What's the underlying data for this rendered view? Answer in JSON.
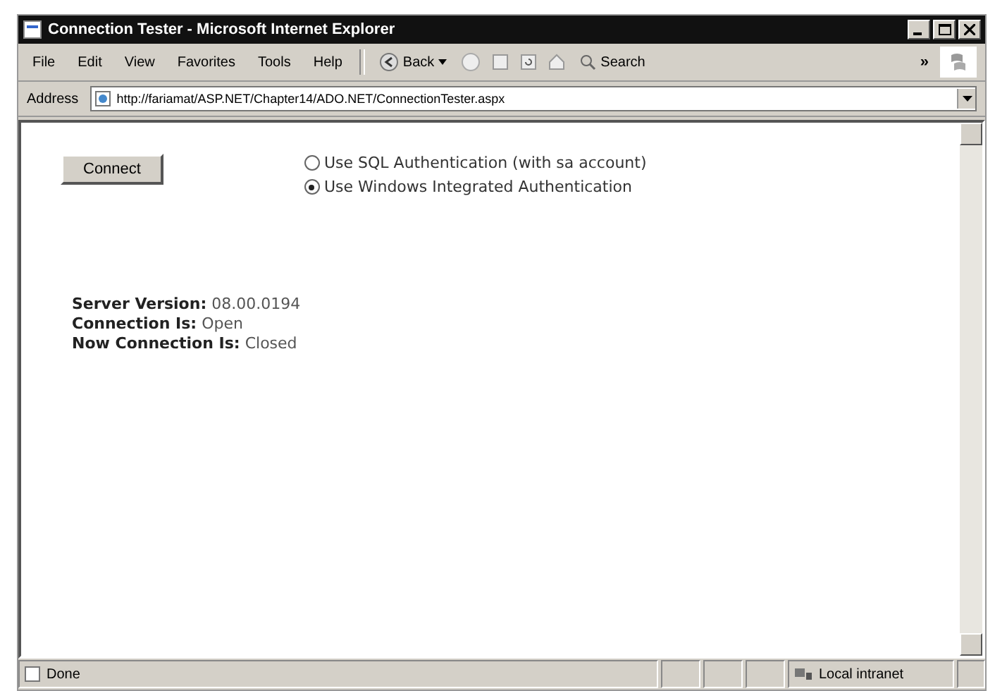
{
  "window": {
    "title": "Connection Tester - Microsoft Internet Explorer"
  },
  "menu": [
    "File",
    "Edit",
    "View",
    "Favorites",
    "Tools",
    "Help"
  ],
  "toolbar": {
    "back": "Back",
    "search": "Search",
    "chevron": "»"
  },
  "address": {
    "label": "Address",
    "value": "http://fariamat/ASP.NET/Chapter14/ADO.NET/ConnectionTester.aspx"
  },
  "connect_button": "Connect",
  "auth_options": [
    {
      "label": "Use SQL Authentication (with sa account)",
      "selected": false
    },
    {
      "label": "Use Windows Integrated Authentication",
      "selected": true
    }
  ],
  "info": [
    {
      "label": "Server Version:",
      "value": "08.00.0194"
    },
    {
      "label": "Connection Is:",
      "value": "Open"
    },
    {
      "label": "Now Connection Is:",
      "value": "Closed"
    }
  ],
  "status_bar": {
    "text": "Done",
    "zone": "Local intranet"
  }
}
